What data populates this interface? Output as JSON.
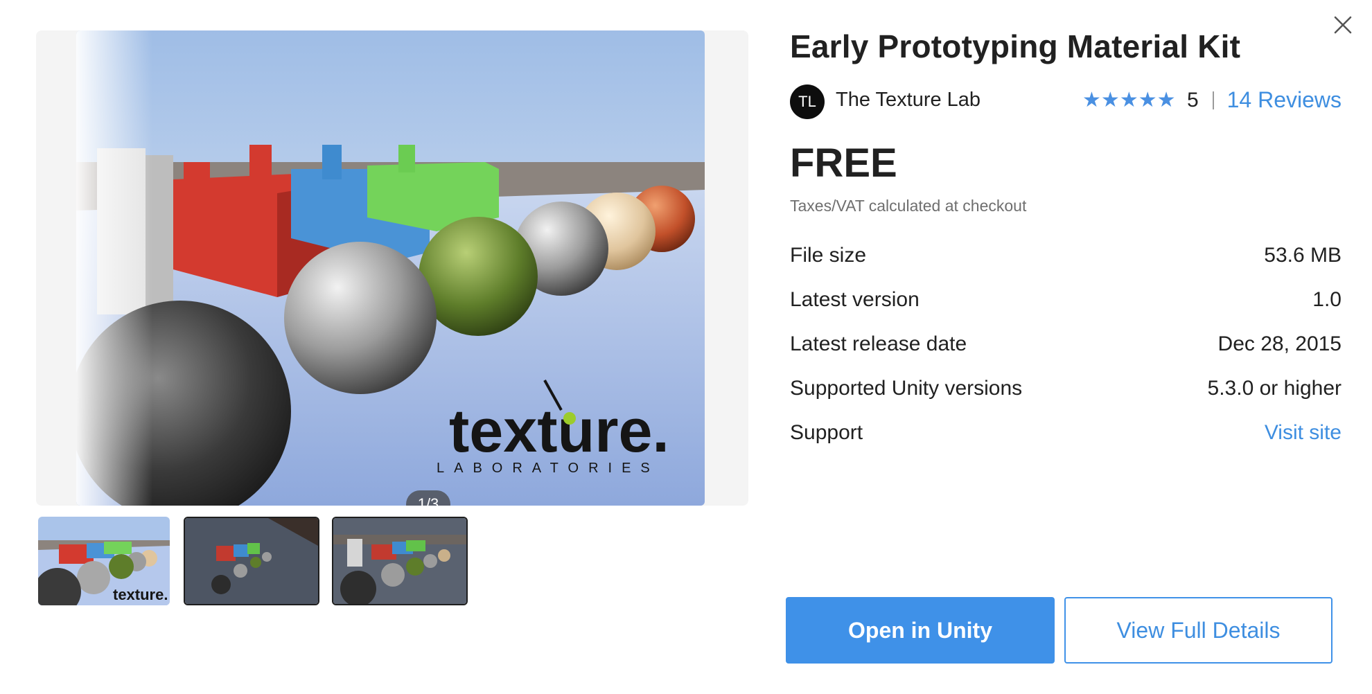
{
  "product": {
    "title": "Early Prototyping Material Kit",
    "publisher": {
      "initials": "TL",
      "name": "The Texture Lab"
    },
    "rating": {
      "stars": 5,
      "value": "5",
      "reviews_label": "14 Reviews"
    },
    "price": "FREE",
    "tax_note": "Taxes/VAT calculated at checkout"
  },
  "details": [
    {
      "label": "File size",
      "value": "53.6 MB"
    },
    {
      "label": "Latest version",
      "value": "1.0"
    },
    {
      "label": "Latest release date",
      "value": "Dec 28, 2015"
    },
    {
      "label": "Supported Unity versions",
      "value": "5.3.0 or higher"
    },
    {
      "label": "Support",
      "value": "Visit site"
    }
  ],
  "gallery": {
    "counter": "1/3",
    "logo_text": "texture.",
    "logo_subtext": "LABORATORIES",
    "current_index": 1,
    "total": 3
  },
  "actions": {
    "open_label": "Open in Unity",
    "details_label": "View Full Details"
  },
  "colors": {
    "accent": "#3f91e8",
    "link": "#3e8ee0",
    "star": "#4a90e2",
    "text": "#212121",
    "muted": "#6f6f6f"
  },
  "icons": {
    "close": "close-icon",
    "star": "star-icon"
  }
}
